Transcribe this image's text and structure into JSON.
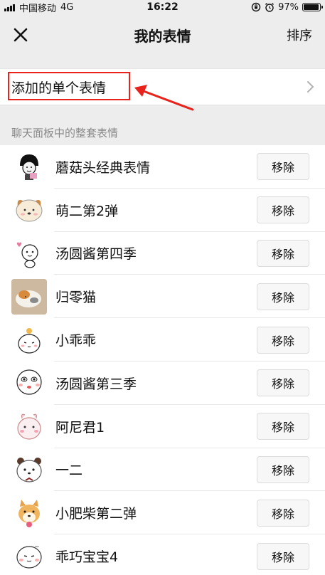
{
  "status": {
    "carrier": "中国移动",
    "network": "4G",
    "time": "16:22",
    "battery": "97%",
    "battery_level": 0.97
  },
  "nav": {
    "title": "我的表情",
    "sort_label": "排序"
  },
  "single": {
    "label": "添加的单个表情"
  },
  "section": {
    "header": "聊天面板中的整套表情"
  },
  "packs": [
    {
      "name": "蘑菇头经典表情",
      "remove_label": "移除"
    },
    {
      "name": "萌二第2弹",
      "remove_label": "移除"
    },
    {
      "name": "汤圆酱第四季",
      "remove_label": "移除"
    },
    {
      "name": "归零猫",
      "remove_label": "移除"
    },
    {
      "name": "小乖乖",
      "remove_label": "移除"
    },
    {
      "name": "汤圆酱第三季",
      "remove_label": "移除"
    },
    {
      "name": "阿尼君1",
      "remove_label": "移除"
    },
    {
      "name": "一二",
      "remove_label": "移除"
    },
    {
      "name": "小肥柴第二弹",
      "remove_label": "移除"
    },
    {
      "name": "乖巧宝宝4",
      "remove_label": "移除"
    }
  ],
  "colors": {
    "highlight": "#e8231b",
    "background": "#ededed"
  }
}
